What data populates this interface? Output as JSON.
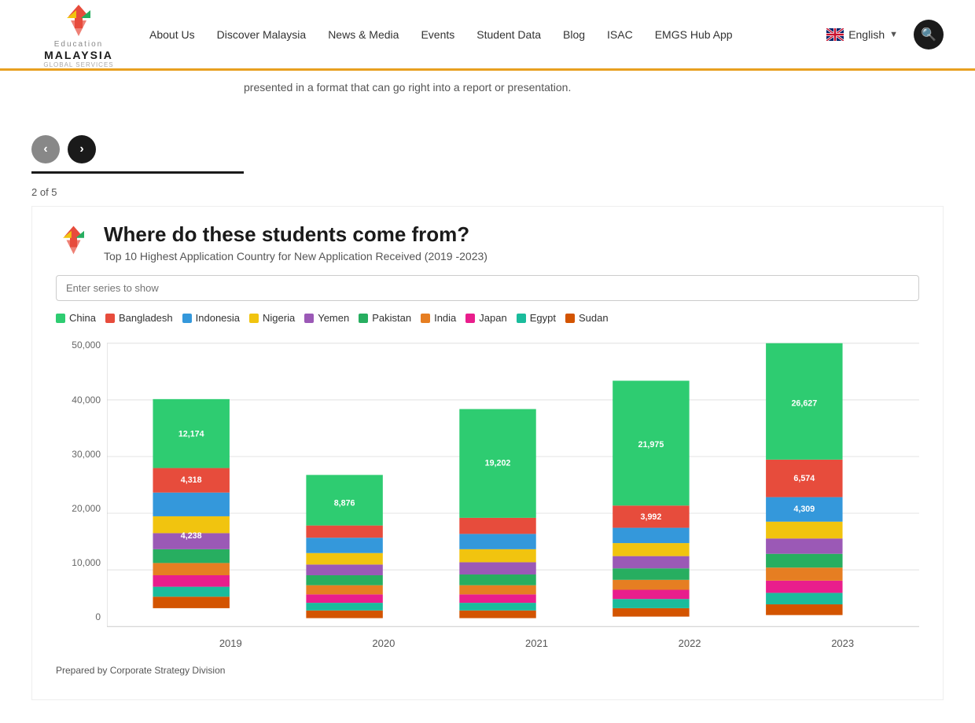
{
  "header": {
    "logo": {
      "edu_label": "Education",
      "malaysia_label": "MALAYSIA",
      "gs_label": "GLOBAL SERVICES"
    },
    "nav": {
      "items": [
        {
          "label": "About Us",
          "href": "#"
        },
        {
          "label": "Discover Malaysia",
          "href": "#"
        },
        {
          "label": "News & Media",
          "href": "#"
        },
        {
          "label": "Events",
          "href": "#"
        },
        {
          "label": "Student Data",
          "href": "#"
        },
        {
          "label": "Blog",
          "href": "#"
        },
        {
          "label": "ISAC",
          "href": "#"
        },
        {
          "label": "EMGS Hub App",
          "href": "#"
        }
      ]
    },
    "language": {
      "label": "English",
      "dropdown_arrow": "▼"
    }
  },
  "intro": {
    "text": "presented in a format that can go right into a report or presentation."
  },
  "carousel": {
    "prev_label": "‹",
    "next_label": "›",
    "page_current": 2,
    "page_total": 5,
    "page_text": "2 of 5"
  },
  "chart": {
    "title": "Where do these students come from?",
    "subtitle": "Top 10 Highest Application Country for New Application Received (2019 -2023)",
    "series_placeholder": "Enter series to show",
    "legend": [
      {
        "label": "China",
        "color": "#2ecc71"
      },
      {
        "label": "Bangladesh",
        "color": "#e74c3c"
      },
      {
        "label": "Indonesia",
        "color": "#3498db"
      },
      {
        "label": "Nigeria",
        "color": "#f1c40f"
      },
      {
        "label": "Yemen",
        "color": "#9b59b6"
      },
      {
        "label": "Pakistan",
        "color": "#27ae60"
      },
      {
        "label": "India",
        "color": "#e67e22"
      },
      {
        "label": "Japan",
        "color": "#e91e8c"
      },
      {
        "label": "Egypt",
        "color": "#1abc9c"
      },
      {
        "label": "Sudan",
        "color": "#d35400"
      }
    ],
    "y_axis": {
      "labels": [
        "50,000",
        "40,000",
        "30,000",
        "20,000",
        "10,000",
        "0"
      ]
    },
    "x_axis": {
      "labels": [
        "2019",
        "2020",
        "2021",
        "2022",
        "2023"
      ]
    },
    "bars": {
      "2019": {
        "china_val": 12174,
        "bangladesh_val": 4318,
        "indonesia_val": 4238,
        "total_height_pct": 65,
        "segments": [
          {
            "color": "#2ecc71",
            "height_pct": 25,
            "label": "12,174"
          },
          {
            "color": "#e74c3c",
            "height_pct": 9,
            "label": "4,318"
          },
          {
            "color": "#3498db",
            "height_pct": 9,
            "label": "4,238"
          },
          {
            "color": "#f1c40f",
            "height_pct": 4,
            "label": ""
          },
          {
            "color": "#9b59b6",
            "height_pct": 4,
            "label": ""
          },
          {
            "color": "#27ae60",
            "height_pct": 3,
            "label": ""
          },
          {
            "color": "#e67e22",
            "height_pct": 3,
            "label": ""
          },
          {
            "color": "#e91e8c",
            "height_pct": 3,
            "label": ""
          },
          {
            "color": "#1abc9c",
            "height_pct": 3,
            "label": ""
          },
          {
            "color": "#d35400",
            "height_pct": 2,
            "label": ""
          }
        ]
      },
      "2020": {
        "china_val": 8876,
        "segments": [
          {
            "color": "#2ecc71",
            "height_pct": 18,
            "label": "8,876"
          },
          {
            "color": "#e74c3c",
            "height_pct": 8,
            "label": ""
          },
          {
            "color": "#3498db",
            "height_pct": 7,
            "label": ""
          },
          {
            "color": "#f1c40f",
            "height_pct": 4,
            "label": ""
          },
          {
            "color": "#9b59b6",
            "height_pct": 3,
            "label": ""
          },
          {
            "color": "#27ae60",
            "height_pct": 3,
            "label": ""
          },
          {
            "color": "#e67e22",
            "height_pct": 3,
            "label": ""
          },
          {
            "color": "#e91e8c",
            "height_pct": 2,
            "label": ""
          },
          {
            "color": "#1abc9c",
            "height_pct": 2,
            "label": ""
          },
          {
            "color": "#d35400",
            "height_pct": 2,
            "label": ""
          }
        ]
      },
      "2021": {
        "china_val": 19202,
        "segments": [
          {
            "color": "#2ecc71",
            "height_pct": 39,
            "label": "19,202"
          },
          {
            "color": "#e74c3c",
            "height_pct": 7,
            "label": ""
          },
          {
            "color": "#3498db",
            "height_pct": 6,
            "label": ""
          },
          {
            "color": "#f1c40f",
            "height_pct": 4,
            "label": ""
          },
          {
            "color": "#9b59b6",
            "height_pct": 3,
            "label": ""
          },
          {
            "color": "#27ae60",
            "height_pct": 3,
            "label": ""
          },
          {
            "color": "#e67e22",
            "height_pct": 3,
            "label": ""
          },
          {
            "color": "#e91e8c",
            "height_pct": 2,
            "label": ""
          },
          {
            "color": "#1abc9c",
            "height_pct": 2,
            "label": ""
          },
          {
            "color": "#d35400",
            "height_pct": 2,
            "label": ""
          }
        ]
      },
      "2022": {
        "china_val": 21975,
        "bangladesh_val": 3992,
        "segments": [
          {
            "color": "#2ecc71",
            "height_pct": 44,
            "label": "21,975"
          },
          {
            "color": "#e74c3c",
            "height_pct": 8,
            "label": "3,992"
          },
          {
            "color": "#3498db",
            "height_pct": 7,
            "label": ""
          },
          {
            "color": "#f1c40f",
            "height_pct": 4,
            "label": ""
          },
          {
            "color": "#9b59b6",
            "height_pct": 4,
            "label": ""
          },
          {
            "color": "#27ae60",
            "height_pct": 3,
            "label": ""
          },
          {
            "color": "#e67e22",
            "height_pct": 3,
            "label": ""
          },
          {
            "color": "#e91e8c",
            "height_pct": 3,
            "label": ""
          },
          {
            "color": "#1abc9c",
            "height_pct": 2,
            "label": ""
          },
          {
            "color": "#d35400",
            "height_pct": 2,
            "label": ""
          }
        ]
      },
      "2023": {
        "china_val": 26627,
        "bangladesh_val": 6574,
        "indonesia_val": 4309,
        "segments": [
          {
            "color": "#2ecc71",
            "height_pct": 54,
            "label": "26,627"
          },
          {
            "color": "#e74c3c",
            "height_pct": 13,
            "label": "6,574"
          },
          {
            "color": "#3498db",
            "height_pct": 9,
            "label": "4,309"
          },
          {
            "color": "#f1c40f",
            "height_pct": 5,
            "label": ""
          },
          {
            "color": "#9b59b6",
            "height_pct": 5,
            "label": ""
          },
          {
            "color": "#27ae60",
            "height_pct": 4,
            "label": ""
          },
          {
            "color": "#e67e22",
            "height_pct": 4,
            "label": ""
          },
          {
            "color": "#e91e8c",
            "height_pct": 3,
            "label": ""
          },
          {
            "color": "#1abc9c",
            "height_pct": 3,
            "label": ""
          },
          {
            "color": "#d35400",
            "height_pct": 2,
            "label": ""
          }
        ]
      }
    }
  },
  "footer": {
    "prepared_by": "Prepared by Corporate Strategy Division"
  }
}
